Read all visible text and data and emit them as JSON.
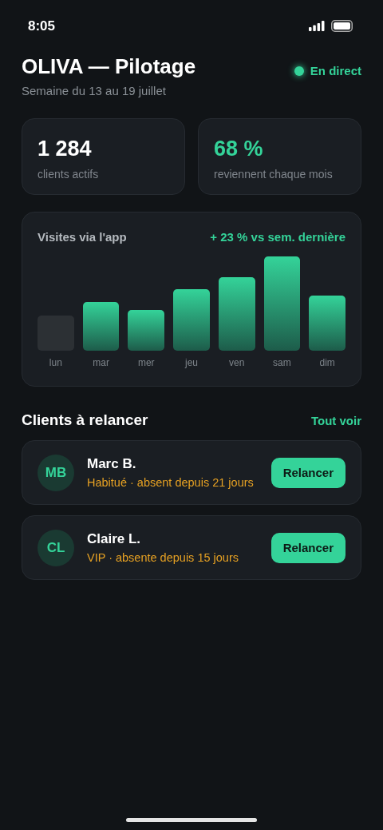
{
  "status_bar": {
    "time": "8:05"
  },
  "header": {
    "title": "OLIVA — Pilotage",
    "subtitle": "Semaine du 13 au 19 juillet",
    "live": {
      "label": "En direct",
      "on": true
    }
  },
  "stats": [
    {
      "value": "1 284",
      "label": "clients actifs",
      "accent": false
    },
    {
      "value": "68 %",
      "label": "reviennent chaque mois",
      "accent": true
    }
  ],
  "visits_card": {
    "title": "Visites via l'app",
    "trend": "+ 23 % vs sem. dernière",
    "days": [
      "lun",
      "mar",
      "mer",
      "jeu",
      "ven",
      "sam",
      "dim"
    ]
  },
  "section": {
    "title": "Clients à relancer",
    "link": "Tout voir"
  },
  "clients": [
    {
      "initials": "MB",
      "name": "Marc B.",
      "status": "Habitué · absent depuis 21 jours",
      "action": "Relancer"
    },
    {
      "initials": "CL",
      "name": "Claire L.",
      "status": "VIP · absente depuis 15 jours",
      "action": "Relancer"
    }
  ]
}
